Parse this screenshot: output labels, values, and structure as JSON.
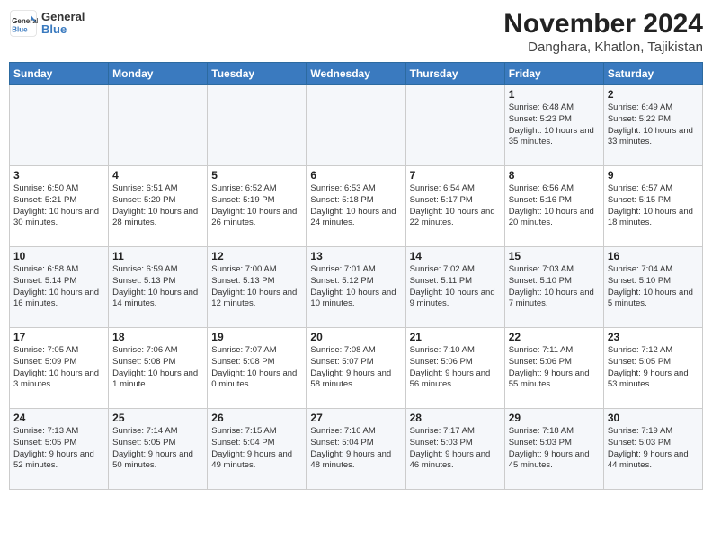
{
  "logo": {
    "text_general": "General",
    "text_blue": "Blue"
  },
  "header": {
    "month_year": "November 2024",
    "location": "Danghara, Khatlon, Tajikistan"
  },
  "weekdays": [
    "Sunday",
    "Monday",
    "Tuesday",
    "Wednesday",
    "Thursday",
    "Friday",
    "Saturday"
  ],
  "weeks": [
    {
      "row": 1,
      "days": [
        {
          "num": "",
          "info": ""
        },
        {
          "num": "",
          "info": ""
        },
        {
          "num": "",
          "info": ""
        },
        {
          "num": "",
          "info": ""
        },
        {
          "num": "",
          "info": ""
        },
        {
          "num": "1",
          "info": "Sunrise: 6:48 AM\nSunset: 5:23 PM\nDaylight: 10 hours and 35 minutes."
        },
        {
          "num": "2",
          "info": "Sunrise: 6:49 AM\nSunset: 5:22 PM\nDaylight: 10 hours and 33 minutes."
        }
      ]
    },
    {
      "row": 2,
      "days": [
        {
          "num": "3",
          "info": "Sunrise: 6:50 AM\nSunset: 5:21 PM\nDaylight: 10 hours and 30 minutes."
        },
        {
          "num": "4",
          "info": "Sunrise: 6:51 AM\nSunset: 5:20 PM\nDaylight: 10 hours and 28 minutes."
        },
        {
          "num": "5",
          "info": "Sunrise: 6:52 AM\nSunset: 5:19 PM\nDaylight: 10 hours and 26 minutes."
        },
        {
          "num": "6",
          "info": "Sunrise: 6:53 AM\nSunset: 5:18 PM\nDaylight: 10 hours and 24 minutes."
        },
        {
          "num": "7",
          "info": "Sunrise: 6:54 AM\nSunset: 5:17 PM\nDaylight: 10 hours and 22 minutes."
        },
        {
          "num": "8",
          "info": "Sunrise: 6:56 AM\nSunset: 5:16 PM\nDaylight: 10 hours and 20 minutes."
        },
        {
          "num": "9",
          "info": "Sunrise: 6:57 AM\nSunset: 5:15 PM\nDaylight: 10 hours and 18 minutes."
        }
      ]
    },
    {
      "row": 3,
      "days": [
        {
          "num": "10",
          "info": "Sunrise: 6:58 AM\nSunset: 5:14 PM\nDaylight: 10 hours and 16 minutes."
        },
        {
          "num": "11",
          "info": "Sunrise: 6:59 AM\nSunset: 5:13 PM\nDaylight: 10 hours and 14 minutes."
        },
        {
          "num": "12",
          "info": "Sunrise: 7:00 AM\nSunset: 5:13 PM\nDaylight: 10 hours and 12 minutes."
        },
        {
          "num": "13",
          "info": "Sunrise: 7:01 AM\nSunset: 5:12 PM\nDaylight: 10 hours and 10 minutes."
        },
        {
          "num": "14",
          "info": "Sunrise: 7:02 AM\nSunset: 5:11 PM\nDaylight: 10 hours and 9 minutes."
        },
        {
          "num": "15",
          "info": "Sunrise: 7:03 AM\nSunset: 5:10 PM\nDaylight: 10 hours and 7 minutes."
        },
        {
          "num": "16",
          "info": "Sunrise: 7:04 AM\nSunset: 5:10 PM\nDaylight: 10 hours and 5 minutes."
        }
      ]
    },
    {
      "row": 4,
      "days": [
        {
          "num": "17",
          "info": "Sunrise: 7:05 AM\nSunset: 5:09 PM\nDaylight: 10 hours and 3 minutes."
        },
        {
          "num": "18",
          "info": "Sunrise: 7:06 AM\nSunset: 5:08 PM\nDaylight: 10 hours and 1 minute."
        },
        {
          "num": "19",
          "info": "Sunrise: 7:07 AM\nSunset: 5:08 PM\nDaylight: 10 hours and 0 minutes."
        },
        {
          "num": "20",
          "info": "Sunrise: 7:08 AM\nSunset: 5:07 PM\nDaylight: 9 hours and 58 minutes."
        },
        {
          "num": "21",
          "info": "Sunrise: 7:10 AM\nSunset: 5:06 PM\nDaylight: 9 hours and 56 minutes."
        },
        {
          "num": "22",
          "info": "Sunrise: 7:11 AM\nSunset: 5:06 PM\nDaylight: 9 hours and 55 minutes."
        },
        {
          "num": "23",
          "info": "Sunrise: 7:12 AM\nSunset: 5:05 PM\nDaylight: 9 hours and 53 minutes."
        }
      ]
    },
    {
      "row": 5,
      "days": [
        {
          "num": "24",
          "info": "Sunrise: 7:13 AM\nSunset: 5:05 PM\nDaylight: 9 hours and 52 minutes."
        },
        {
          "num": "25",
          "info": "Sunrise: 7:14 AM\nSunset: 5:05 PM\nDaylight: 9 hours and 50 minutes."
        },
        {
          "num": "26",
          "info": "Sunrise: 7:15 AM\nSunset: 5:04 PM\nDaylight: 9 hours and 49 minutes."
        },
        {
          "num": "27",
          "info": "Sunrise: 7:16 AM\nSunset: 5:04 PM\nDaylight: 9 hours and 48 minutes."
        },
        {
          "num": "28",
          "info": "Sunrise: 7:17 AM\nSunset: 5:03 PM\nDaylight: 9 hours and 46 minutes."
        },
        {
          "num": "29",
          "info": "Sunrise: 7:18 AM\nSunset: 5:03 PM\nDaylight: 9 hours and 45 minutes."
        },
        {
          "num": "30",
          "info": "Sunrise: 7:19 AM\nSunset: 5:03 PM\nDaylight: 9 hours and 44 minutes."
        }
      ]
    }
  ]
}
